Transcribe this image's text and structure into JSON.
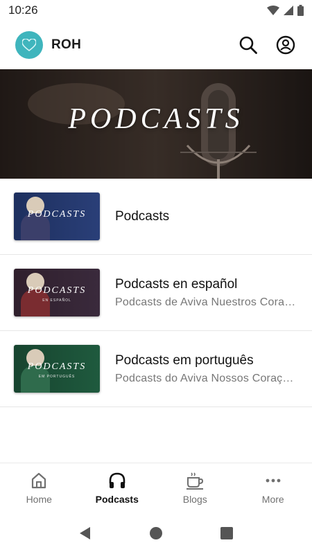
{
  "status_bar": {
    "time": "10:26"
  },
  "header": {
    "app_name": "ROH",
    "logo_icon": "heart-icon",
    "accent": "#3fb5bd"
  },
  "hero": {
    "title": "PODCASTS"
  },
  "podcasts": [
    {
      "title": "Podcasts",
      "subtitle": "",
      "thumb_text": "PODCASTS",
      "thumb_sub": "",
      "thumb_color": "#2a3f78"
    },
    {
      "title": "Podcasts en español",
      "subtitle": "Podcasts de Aviva Nuestros Corazones",
      "thumb_text": "PODCASTS",
      "thumb_sub": "EN ESPAÑOL",
      "thumb_color": "#3a2a3c"
    },
    {
      "title": "Podcasts em português",
      "subtitle": "Podcasts do Aviva Nossos Corações",
      "thumb_text": "PODCASTS",
      "thumb_sub": "EM PORTUGUÊS",
      "thumb_color": "#1f5a3e"
    }
  ],
  "bottom_nav": [
    {
      "label": "Home",
      "icon": "home-icon",
      "active": false
    },
    {
      "label": "Podcasts",
      "icon": "headphones-icon",
      "active": true
    },
    {
      "label": "Blogs",
      "icon": "coffee-cup-icon",
      "active": false
    },
    {
      "label": "More",
      "icon": "more-dots-icon",
      "active": false
    }
  ]
}
